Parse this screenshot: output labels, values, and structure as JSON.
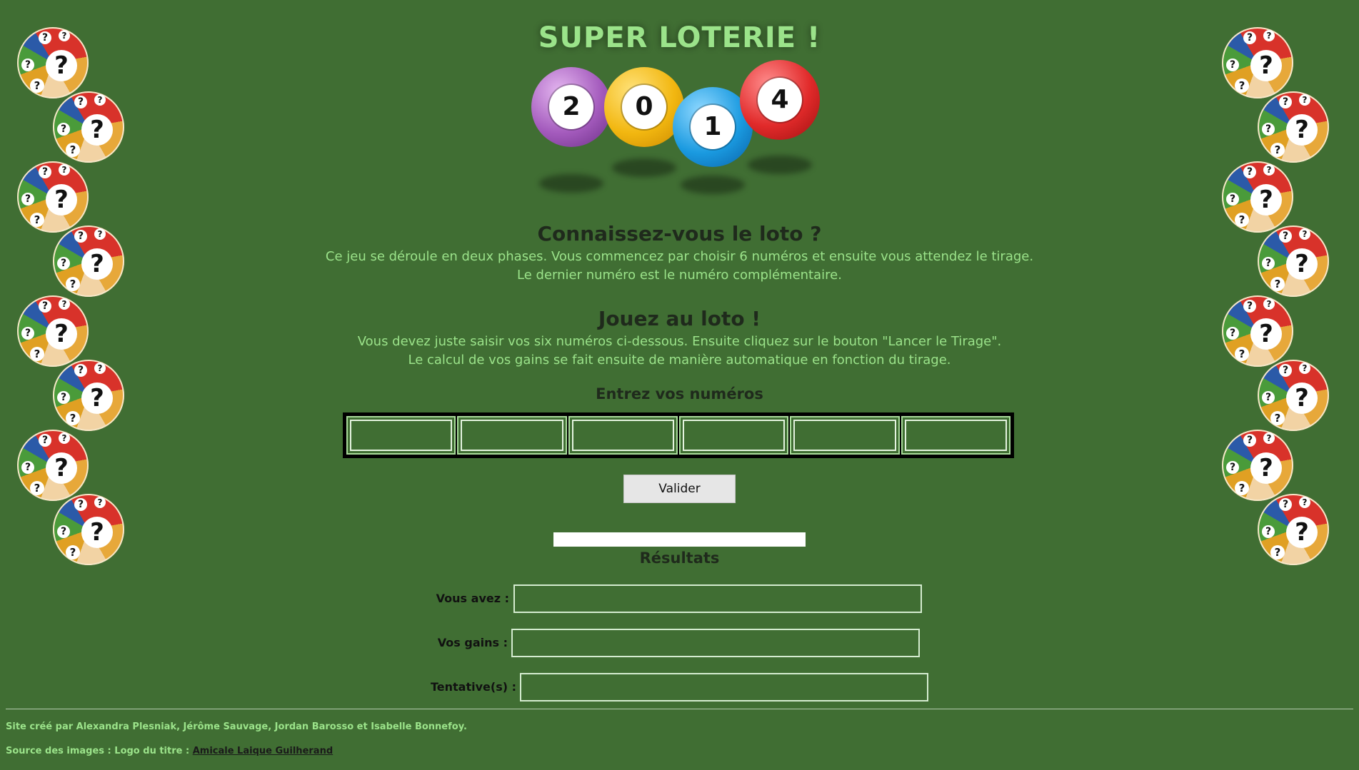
{
  "header": {
    "title": "SUPER LOTERIE !",
    "year_balls": [
      "2",
      "0",
      "1",
      "4"
    ]
  },
  "intro": {
    "title": "Connaissez-vous le loto ?",
    "line1": "Ce jeu se déroule en deux phases. Vous commencez par choisir 6 numéros et ensuite vous attendez le tirage.",
    "line2": "Le dernier numéro est le numéro complémentaire."
  },
  "play": {
    "title": "Jouez au loto !",
    "line1": "Vous devez juste saisir vos six numéros ci-dessous. Ensuite cliquez sur le bouton \"Lancer le Tirage\".",
    "line2": "Le calcul de vos gains se fait ensuite de manière automatique en fonction du tirage."
  },
  "entry": {
    "title": "Entrez vos numéros",
    "numbers": [
      "",
      "",
      "",
      "",
      "",
      ""
    ],
    "submit_label": "Valider"
  },
  "results": {
    "progress": 0,
    "title": "Résultats",
    "fields": [
      {
        "label": "Vous avez :",
        "value": ""
      },
      {
        "label": "Vos gains :",
        "value": ""
      },
      {
        "label": "Tentative(s) :",
        "value": ""
      }
    ]
  },
  "footer": {
    "credits": "Site créé par Alexandra Plesniak, Jérôme Sauvage, Jordan Barosso et Isabelle Bonnefoy.",
    "source_prefix": "Source des images : Logo du titre : ",
    "source_link": "Amicale Laique Guilherand"
  },
  "colors": {
    "background": "#406e33",
    "accent_text": "#9be38a",
    "heading_text": "#1f2a1c"
  }
}
